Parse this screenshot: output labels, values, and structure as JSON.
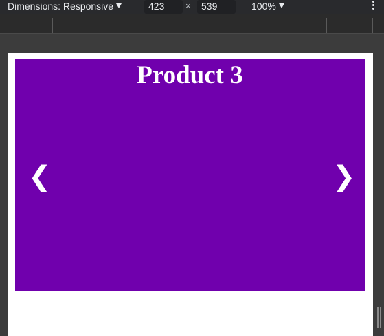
{
  "toolbar": {
    "dimensions_label": "Dimensions: Responsive",
    "width_value": "423",
    "height_value": "539",
    "times_symbol": "×",
    "zoom_label": "100%"
  },
  "icons": {
    "dimensions_dropdown": "chevron-down-icon",
    "zoom_dropdown": "chevron-down-icon",
    "more": "more-vertical-icon",
    "resize": "resize-handle-icon"
  },
  "slideshow": {
    "title": "Product 3",
    "prev_arrow": "❮",
    "next_arrow": "❯",
    "background_color": "#7000ad"
  }
}
